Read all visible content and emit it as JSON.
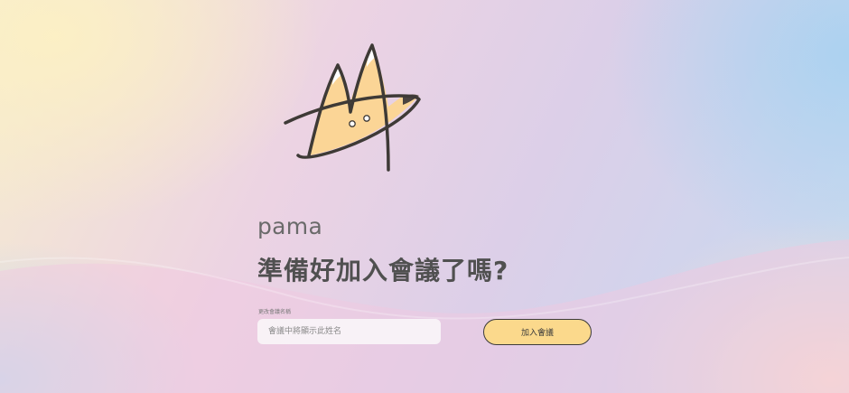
{
  "app": {
    "user_name": "pama",
    "headline": "準備好加入會議了嗎?"
  },
  "form": {
    "name_label": "更改會議名稱",
    "name_placeholder": "會議中將顯示此姓名",
    "name_value": "",
    "join_label": "加入會議"
  },
  "colors": {
    "join_button": "#fbd98c",
    "logo_fill": "#fbd596",
    "logo_stroke": "#3e3a36",
    "headline_text": "#505050"
  },
  "icons": {
    "logo": "cat-m-logo"
  }
}
